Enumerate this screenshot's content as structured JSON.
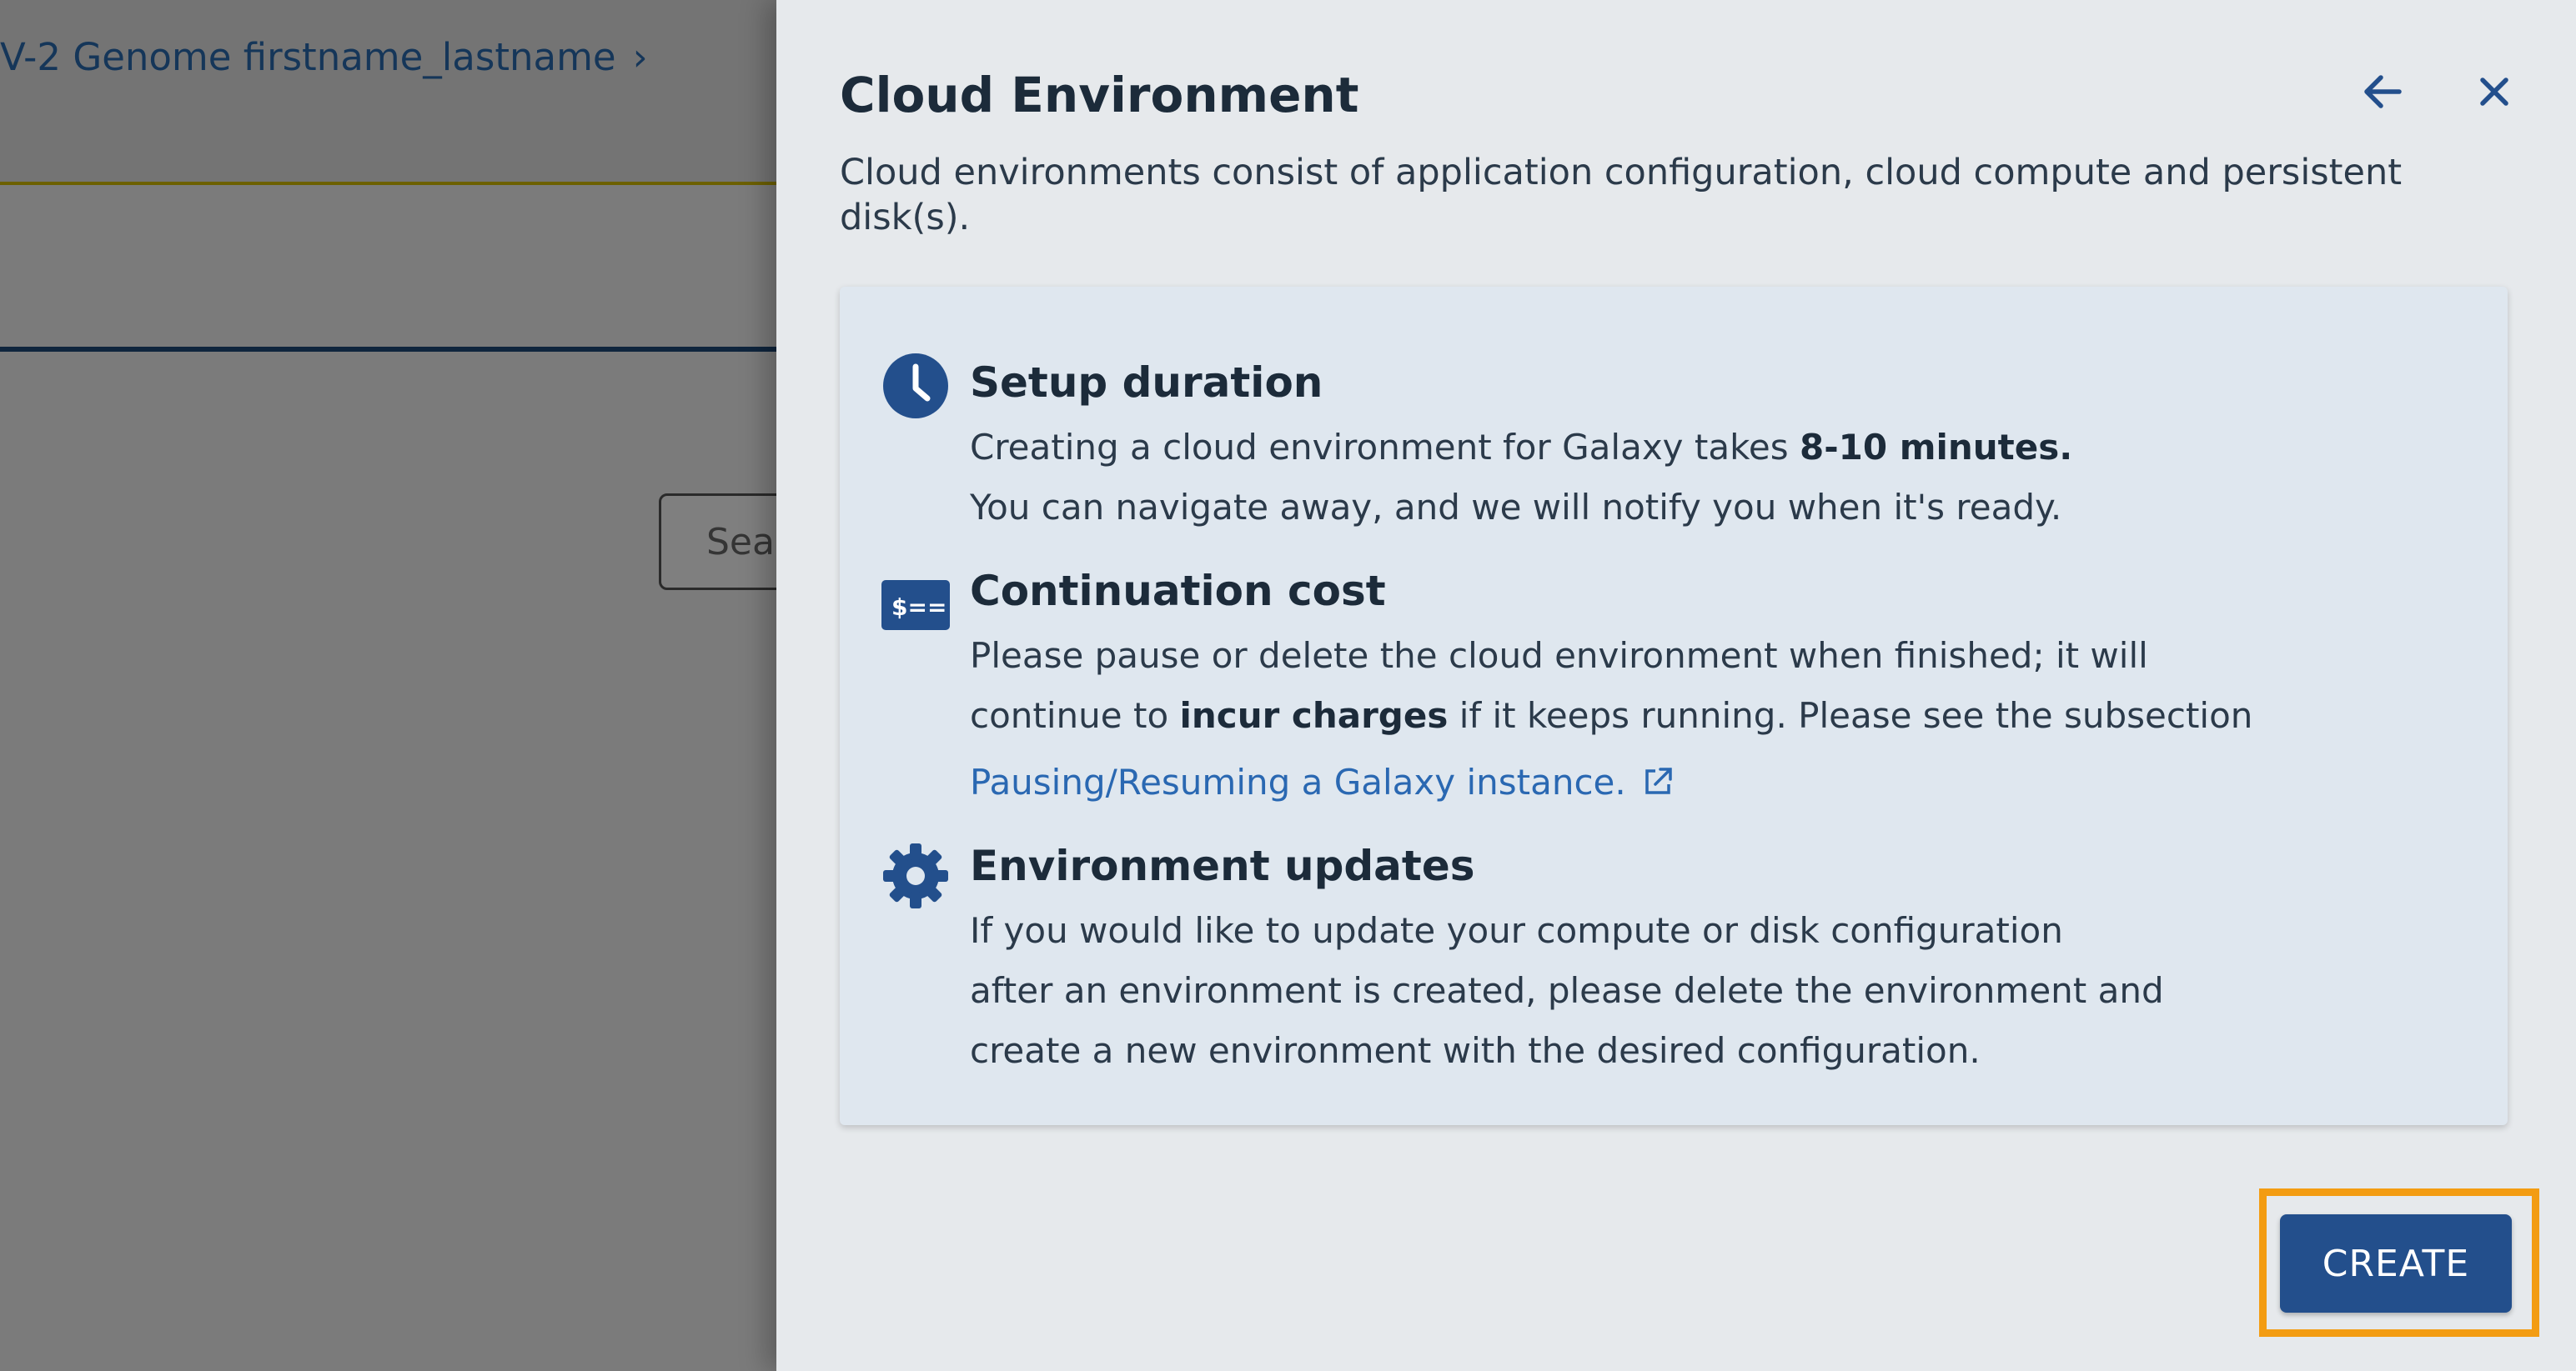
{
  "background": {
    "breadcrumb": "V-2 Genome firstname_lastname",
    "breadcrumb_chevron": "›",
    "search_placeholder": "Sea"
  },
  "panel": {
    "title": "Cloud Environment",
    "description": "Cloud environments consist of application configuration, cloud compute and persistent disk(s).",
    "back_icon": "arrow-left-icon",
    "close_icon": "close-icon"
  },
  "sections": {
    "setup": {
      "icon": "clock-icon",
      "title": "Setup duration",
      "line1_pre": "Creating a cloud environment for Galaxy takes ",
      "line1_bold": "8-10 minutes.",
      "line2": "You can navigate away, and we will notify you when it's ready."
    },
    "cost": {
      "icon": "billing-icon",
      "icon_glyph": "$==",
      "title": "Continuation cost",
      "line1": "Please pause or delete the cloud environment when finished; it will",
      "line2_pre": "continue to ",
      "line2_bold": "incur charges",
      "line2_post": " if it keeps running. Please see the subsection",
      "link": "Pausing/Resuming a Galaxy instance.",
      "link_icon": "external-link-icon"
    },
    "updates": {
      "icon": "gear-icon",
      "title": "Environment updates",
      "line1": "If you would like to update your compute or disk configuration",
      "line2": "after an environment is created, please delete the environment and",
      "line3": "create a new environment with the desired configuration."
    }
  },
  "actions": {
    "create_label": "CREATE"
  },
  "colors": {
    "accent": "#234f8c",
    "highlight": "#f39c12",
    "link": "#2a68b2",
    "panel_bg": "#e6e9ec",
    "card_bg": "#dfe7ef"
  }
}
